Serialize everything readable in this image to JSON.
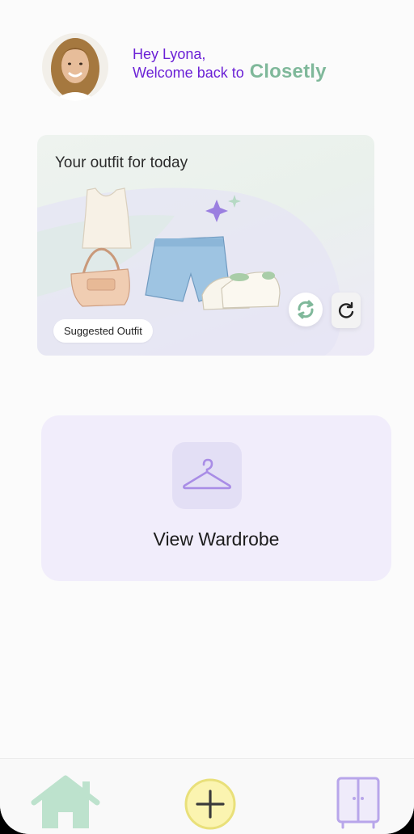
{
  "header": {
    "greeting_line1": "Hey Lyona,",
    "greeting_line2": "Welcome back to",
    "brand": "Closetly"
  },
  "outfit_card": {
    "title": "Your outfit for today",
    "badge": "Suggested Outfit"
  },
  "wardrobe_card": {
    "label": "View Wardrobe"
  },
  "colors": {
    "accent_purple": "#6b21d6",
    "brand_green": "#7fb89a",
    "wardrobe_bg": "#f1edfb",
    "nav_add_fill": "#fbf4b0"
  }
}
